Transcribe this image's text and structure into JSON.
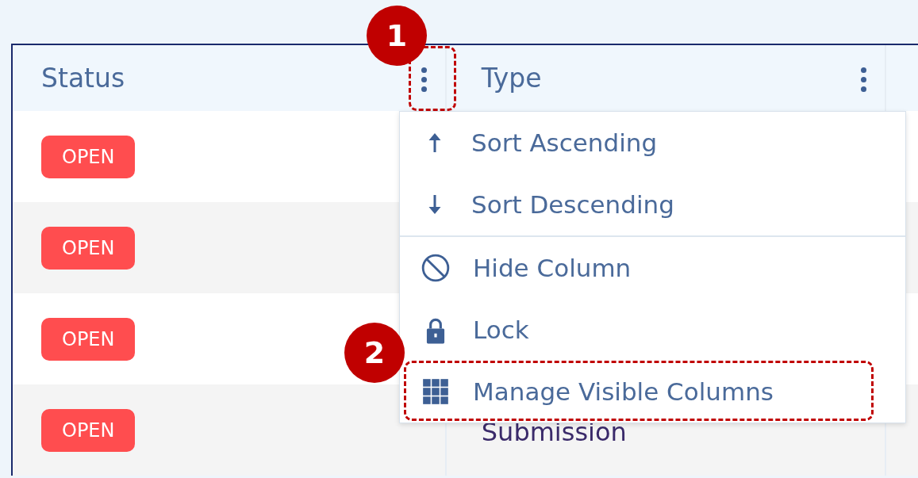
{
  "table": {
    "columns": [
      {
        "label": "Status",
        "annotated": true
      },
      {
        "label": "Type",
        "annotated": false
      }
    ],
    "rows": [
      {
        "status": "OPEN",
        "type": ""
      },
      {
        "status": "OPEN",
        "type": ""
      },
      {
        "status": "OPEN",
        "type": ""
      },
      {
        "status": "OPEN",
        "type": "Submission"
      }
    ]
  },
  "column_menu": {
    "items": [
      {
        "label": "Sort Ascending",
        "divider_before": false,
        "annotated": false
      },
      {
        "label": "Sort Descending",
        "divider_before": false,
        "annotated": false
      },
      {
        "label": "Hide Column",
        "divider_before": true,
        "annotated": false
      },
      {
        "label": "Lock",
        "divider_before": false,
        "annotated": false
      },
      {
        "label": "Manage Visible Columns",
        "divider_before": false,
        "annotated": true
      }
    ]
  },
  "callouts": [
    "1",
    "2"
  ]
}
